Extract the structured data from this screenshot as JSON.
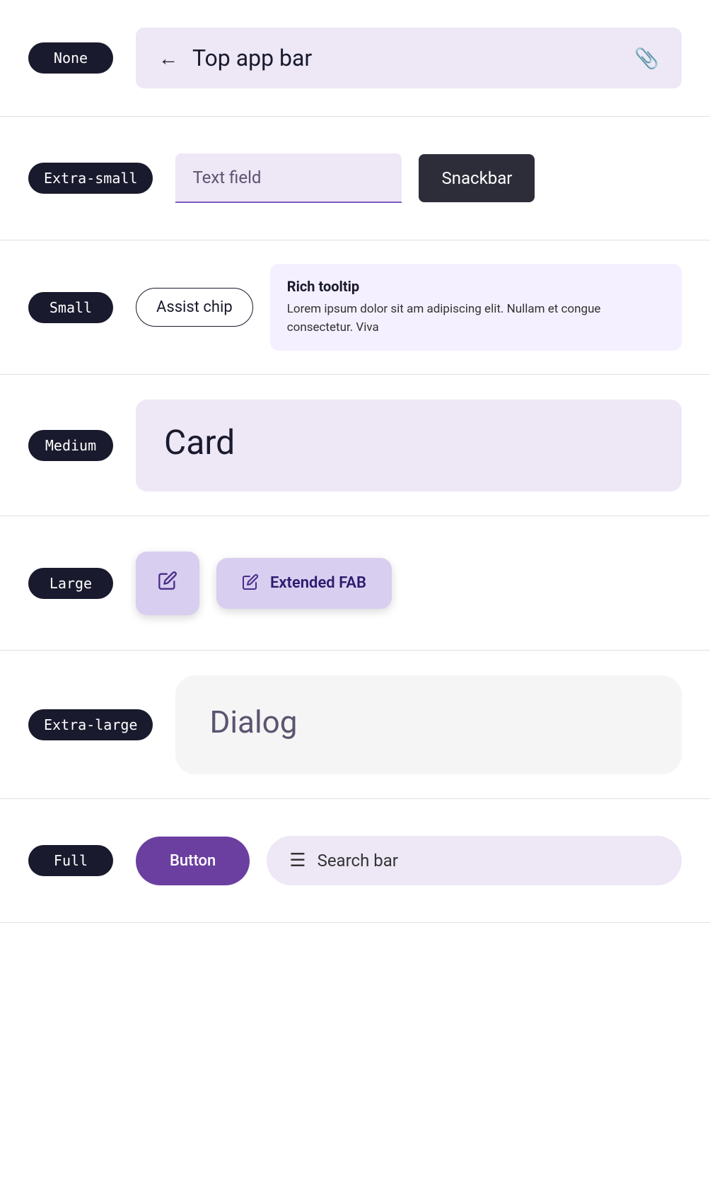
{
  "rows": [
    {
      "id": "none",
      "badge": "None",
      "components": {
        "top_app_bar": {
          "back_icon": "←",
          "title": "Top app bar",
          "attach_icon": "📎"
        }
      }
    },
    {
      "id": "extra-small",
      "badge": "Extra-small",
      "components": {
        "text_field": {
          "placeholder": "Text field"
        },
        "snackbar": {
          "label": "Snackbar"
        }
      }
    },
    {
      "id": "small",
      "badge": "Small",
      "components": {
        "assist_chip": {
          "label": "Assist chip"
        },
        "rich_tooltip": {
          "title": "Rich tooltip",
          "body": "Lorem ipsum dolor sit am adipiscing elit. Nullam et congue consectetur. Viva"
        }
      }
    },
    {
      "id": "medium",
      "badge": "Medium",
      "components": {
        "card": {
          "title": "Card"
        }
      }
    },
    {
      "id": "large",
      "badge": "Large",
      "components": {
        "fab": {
          "icon": "✏️"
        },
        "extended_fab": {
          "icon": "✏️",
          "label": "Extended FAB"
        }
      }
    },
    {
      "id": "extra-large",
      "badge": "Extra-large",
      "components": {
        "dialog": {
          "title": "Dialog"
        }
      }
    },
    {
      "id": "full",
      "badge": "Full",
      "components": {
        "button": {
          "label": "Button"
        },
        "search_bar": {
          "icon": "☰",
          "label": "Search bar"
        }
      }
    }
  ]
}
